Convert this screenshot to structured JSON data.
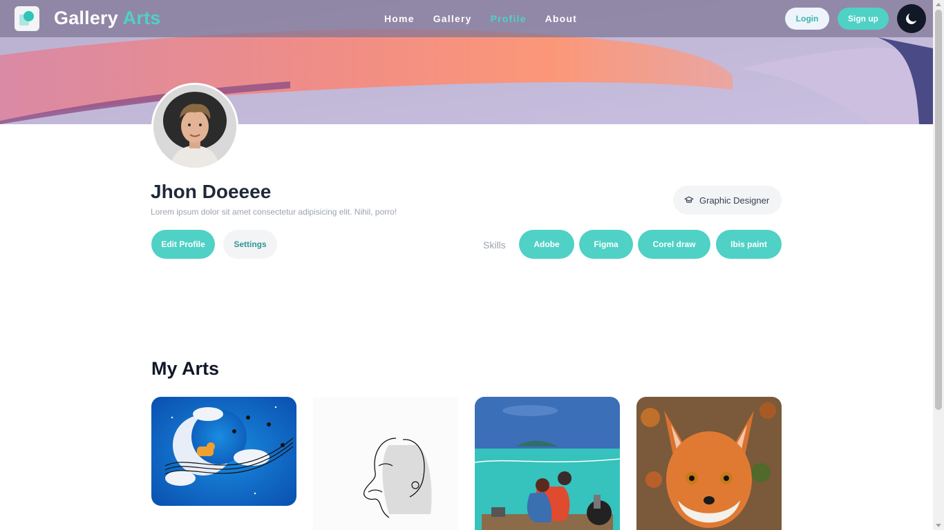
{
  "app": {
    "brand_main": "Gallery",
    "brand_accent": "Arts",
    "accent_color": "#4fd1c5"
  },
  "nav": {
    "links": [
      {
        "label": "Home",
        "active": false
      },
      {
        "label": "Gallery",
        "active": false
      },
      {
        "label": "Profile",
        "active": true
      },
      {
        "label": "About",
        "active": false
      }
    ],
    "login_label": "Login",
    "signup_label": "Sign up",
    "theme_icon": "moon-icon"
  },
  "profile": {
    "name": "Jhon Doeeee",
    "bio": "Lorem ipsum dolor sit amet consectetur adipisicing elit. Nihil, porro!",
    "role": "Graphic Designer",
    "role_icon": "graduation-cap-icon",
    "edit_label": "Edit Profile",
    "settings_label": "Settings",
    "skills_label": "Skills",
    "skills": [
      "Adobe",
      "Figma",
      "Corel draw",
      "Ibis paint"
    ]
  },
  "arts": {
    "title": "My Arts",
    "items": [
      {
        "icon": "moon-tiger-music-art"
      },
      {
        "icon": "line-art-face-art"
      },
      {
        "icon": "couple-by-sea-art"
      },
      {
        "icon": "fox-portrait-art"
      }
    ]
  }
}
